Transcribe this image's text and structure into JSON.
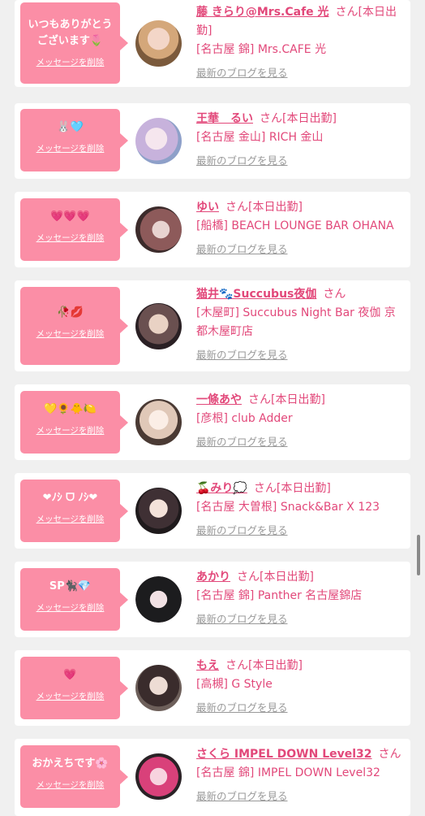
{
  "delete_label": "メッセージを削除",
  "blog_label": "最新のブログを見る",
  "cards": [
    {
      "message": "いつもありがとう\nございます🌷",
      "name": "藤 きらり@Mrs.Cafe 光",
      "suffix": "さん[本日出勤]",
      "shop": "[名古屋 錦] Mrs.CAFE 光"
    },
    {
      "message": "🐰🩵",
      "name": "王華　るい",
      "suffix": "さん[本日出勤]",
      "shop": "[名古屋 金山] RICH 金山"
    },
    {
      "message": "💗💗💗",
      "name": "ゆい",
      "suffix": "さん[本日出勤]",
      "shop": "[船橋] BEACH LOUNGE BAR OHANA"
    },
    {
      "message": "🥀💋",
      "name": "猫井🐾Succubus夜伽",
      "suffix": "さん",
      "shop": "[木屋町] Succubus Night Bar 夜伽 京都木屋町店"
    },
    {
      "message": "💛🌻🐥🍋",
      "name": "一條あや",
      "suffix": "さん[本日出勤]",
      "shop": "[彦根] club Adder"
    },
    {
      "message": "❤︎ﾉｼ ᗜ ﾉｼ❤︎",
      "name": "🍒みり💭",
      "suffix": "さん[本日出勤]",
      "shop": "[名古屋 大曽根] Snack&Bar X 123"
    },
    {
      "message": "SP🐈‍⬛💎",
      "name": "あかり",
      "suffix": "さん[本日出勤]",
      "shop": "[名古屋 錦] Panther 名古屋錦店"
    },
    {
      "message": "💗",
      "name": "もえ",
      "suffix": "さん[本日出勤]",
      "shop": "[高槻] G Style"
    },
    {
      "message": "おかえちです🌸",
      "name": "さくら IMPEL DOWN Level32",
      "suffix": "さん",
      "shop": "[名古屋 錦] IMPEL DOWN Level32"
    }
  ]
}
